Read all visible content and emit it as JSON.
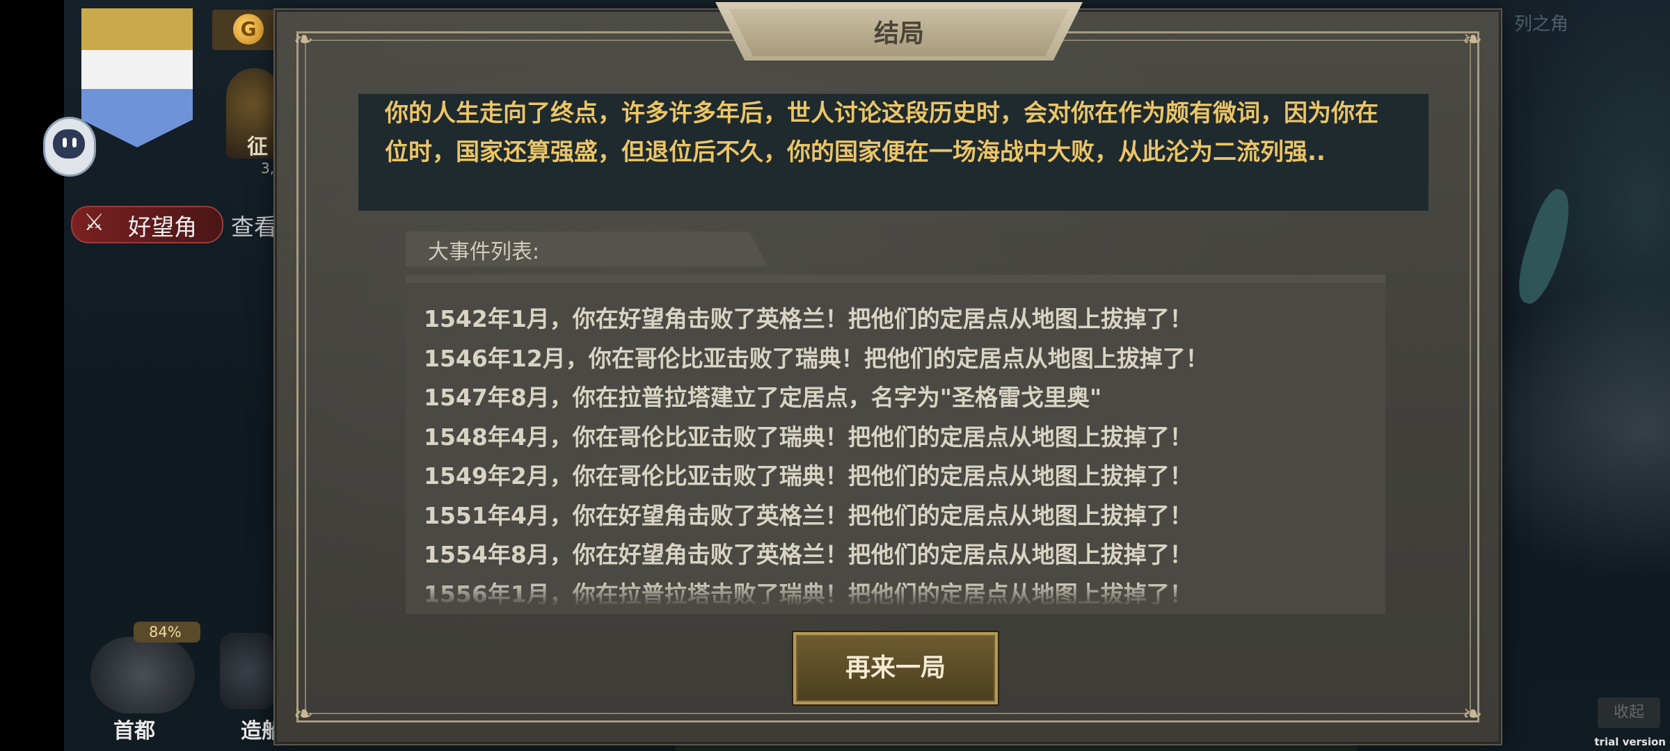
{
  "dialog": {
    "title": "结局",
    "story_text": "你的人生走向了终点，许多许多年后，世人讨论这段历史时，会对你在作为颇有微词，因为你在位时，国家还算强盛，但退位后不久，你的国家便在一场海战中大败，从此沦为二流列强..",
    "events_header": "大事件列表:",
    "events": [
      "1542年1月，你在好望角击败了英格兰！把他们的定居点从地图上拔掉了！",
      "1546年12月，你在哥伦比亚击败了瑞典！把他们的定居点从地图上拔掉了！",
      "1547年8月，你在拉普拉塔建立了定居点，名字为\"圣格雷戈里奥\"",
      "1548年4月，你在哥伦比亚击败了瑞典！把他们的定居点从地图上拔掉了！",
      "1549年2月，你在哥伦比亚击败了瑞典！把他们的定居点从地图上拔掉了！",
      "1551年4月，你在好望角击败了英格兰！把他们的定居点从地图上拔掉了！",
      "1554年8月，你在好望角击败了英格兰！把他们的定居点从地图上拔掉了！",
      "1556年1月，你在拉普拉塔击败了瑞典！把他们的定居点从地图上拔掉了！"
    ],
    "replay_button": "再来一局"
  },
  "background": {
    "coin_icon": "G",
    "rank_label": "征",
    "rank_sub": "3,",
    "location_label": "好望角",
    "view_label": "查看",
    "capital_percent": "84%",
    "capital_label": "首都",
    "shipyard_label": "造船",
    "map_label": "列之角",
    "collapse_label": "收起",
    "watermark": "trial version"
  }
}
